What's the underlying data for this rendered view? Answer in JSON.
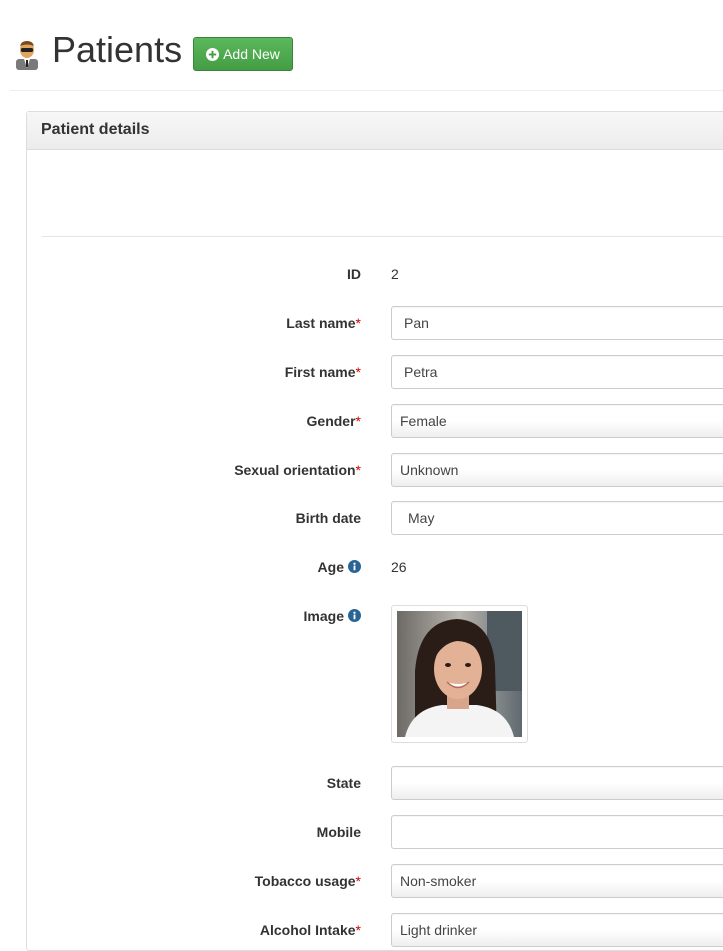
{
  "header": {
    "title": "Patients",
    "add_button_label": "Add New",
    "icons": {
      "title": "doctor-avatar-icon",
      "add": "plus-circle-icon"
    },
    "colors": {
      "add_button": "#5cb85c"
    }
  },
  "panel": {
    "heading": "Patient details"
  },
  "form": {
    "id": {
      "label": "ID",
      "value": "2"
    },
    "last_name": {
      "label": "Last name",
      "required": "*",
      "value": "Pan"
    },
    "first_name": {
      "label": "First name",
      "required": "*",
      "value": "Petra"
    },
    "gender": {
      "label": "Gender",
      "required": "*",
      "value": "Female"
    },
    "sexual_orientation": {
      "label": "Sexual orientation",
      "required": "*",
      "value": "Unknown"
    },
    "birth_date": {
      "label": "Birth date",
      "value": "May"
    },
    "age": {
      "label": "Age",
      "value": "26",
      "icon": "info-circle-icon"
    },
    "image": {
      "label": "Image",
      "icon": "info-circle-icon"
    },
    "state": {
      "label": "State",
      "value": ""
    },
    "mobile": {
      "label": "Mobile",
      "value": ""
    },
    "tobacco": {
      "label": "Tobacco usage",
      "required": "*",
      "value": "Non-smoker"
    },
    "alcohol": {
      "label": "Alcohol Intake",
      "required": "*",
      "value": "Light drinker"
    }
  }
}
